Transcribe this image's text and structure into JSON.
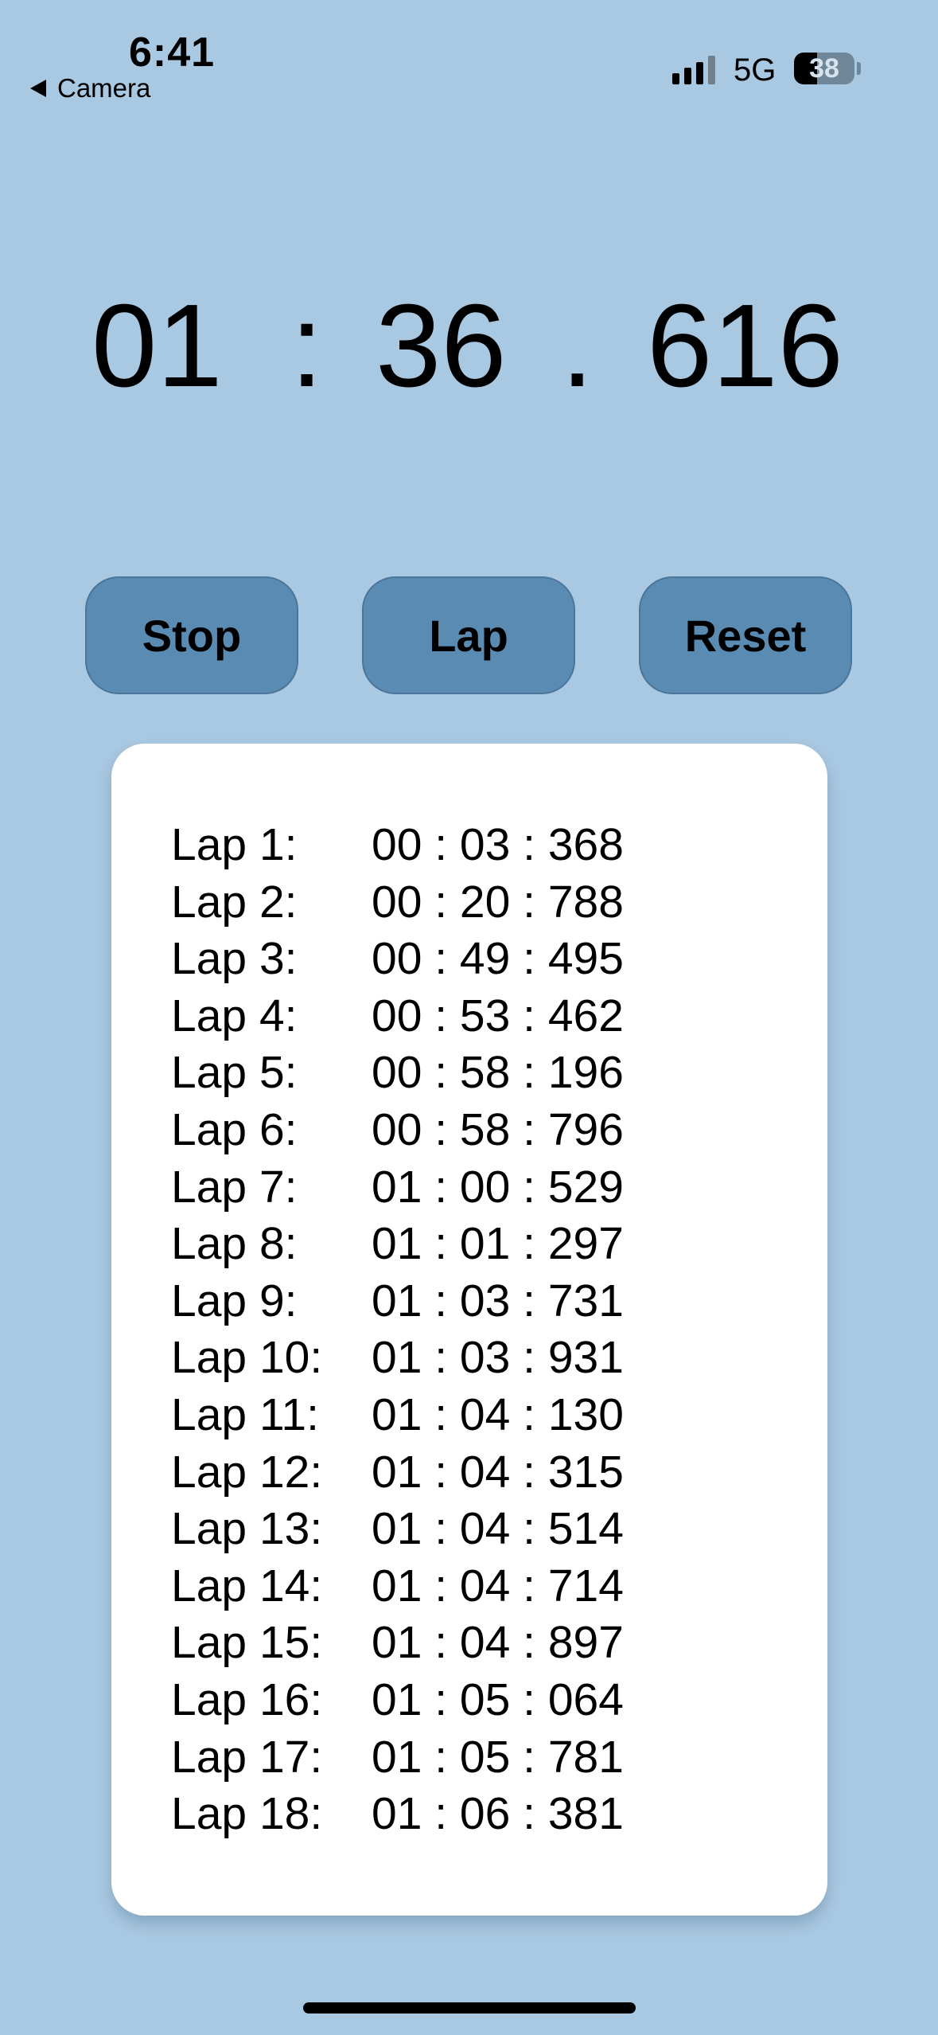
{
  "status_bar": {
    "time": "6:41",
    "back_label": "Camera",
    "network": "5G",
    "battery_level": "38",
    "battery_fraction": 0.38,
    "signal_bars_active": 3,
    "signal_bars_total": 4
  },
  "timer": {
    "minutes": "01",
    "sep1": ":",
    "seconds": "36",
    "sep2": ".",
    "milliseconds": "616"
  },
  "buttons": {
    "stop": "Stop",
    "lap": "Lap",
    "reset": "Reset"
  },
  "laps": [
    {
      "label": "Lap 1:",
      "time": "00 : 03 : 368"
    },
    {
      "label": "Lap 2:",
      "time": "00 : 20 : 788"
    },
    {
      "label": "Lap 3:",
      "time": "00 : 49 : 495"
    },
    {
      "label": "Lap 4:",
      "time": "00 : 53 : 462"
    },
    {
      "label": "Lap 5:",
      "time": "00 : 58 : 196"
    },
    {
      "label": "Lap 6:",
      "time": "00 : 58 : 796"
    },
    {
      "label": "Lap 7:",
      "time": "01 : 00 : 529"
    },
    {
      "label": "Lap 8:",
      "time": "01 : 01 : 297"
    },
    {
      "label": "Lap 9:",
      "time": "01 : 03 : 731"
    },
    {
      "label": "Lap 10:",
      "time": "01 : 03 : 931"
    },
    {
      "label": "Lap 11:",
      "time": "01 : 04 : 130"
    },
    {
      "label": "Lap 12:",
      "time": "01 : 04 : 315"
    },
    {
      "label": "Lap 13:",
      "time": "01 : 04 : 514"
    },
    {
      "label": "Lap 14:",
      "time": "01 : 04 : 714"
    },
    {
      "label": "Lap 15:",
      "time": "01 : 04 : 897"
    },
    {
      "label": "Lap 16:",
      "time": "01 : 05 : 064"
    },
    {
      "label": "Lap 17:",
      "time": "01 : 05 : 781"
    },
    {
      "label": "Lap 18:",
      "time": "01 : 06 : 381"
    }
  ],
  "colors": {
    "background": "#a9c8e1",
    "button": "#5a8cb3",
    "card": "#ffffff"
  }
}
